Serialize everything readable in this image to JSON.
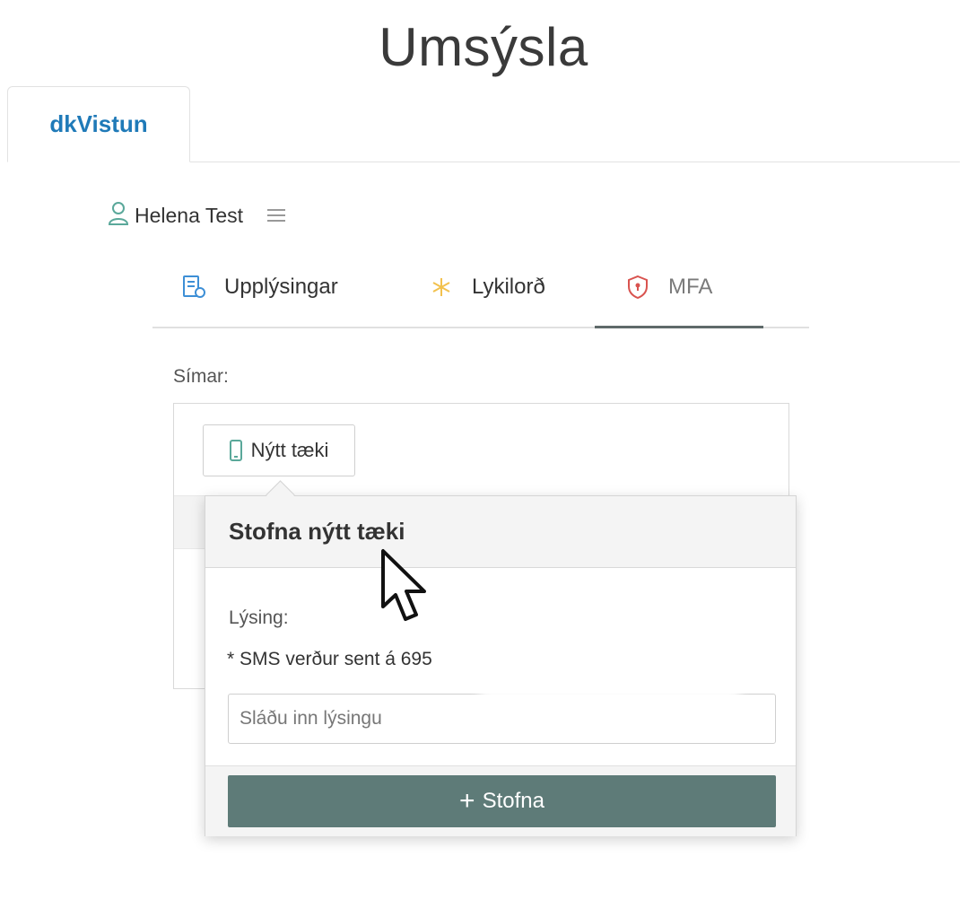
{
  "page": {
    "title": "Umsýsla"
  },
  "app_tabs": [
    {
      "label": "dkVistun",
      "active": true
    }
  ],
  "user": {
    "name": "Helena Test",
    "icon": "user-icon",
    "menu_icon": "hamburger-menu-icon"
  },
  "tabs": [
    {
      "label": "Upplýsingar",
      "icon": "document-icon",
      "active": false
    },
    {
      "label": "Lykilorð",
      "icon": "asterisk-icon",
      "active": false
    },
    {
      "label": "MFA",
      "icon": "shield-icon",
      "active": true
    }
  ],
  "phones": {
    "label": "Símar:",
    "new_device_label": "Nýtt tæki",
    "new_device_icon": "phone-icon"
  },
  "popover": {
    "title": "Stofna nýtt tæki",
    "description_label": "Lýsing:",
    "sms_note": "* SMS verður sent á 695",
    "input_placeholder": "Sláðu inn lýsingu",
    "input_value": "",
    "create_label": "Stofna",
    "create_icon": "plus-icon"
  },
  "colors": {
    "brand_blue": "#1f7ab8",
    "primary_button": "#5e7b78",
    "asterisk": "#f2c14e",
    "shield": "#d9534f",
    "user_icon": "#5aa89a"
  }
}
